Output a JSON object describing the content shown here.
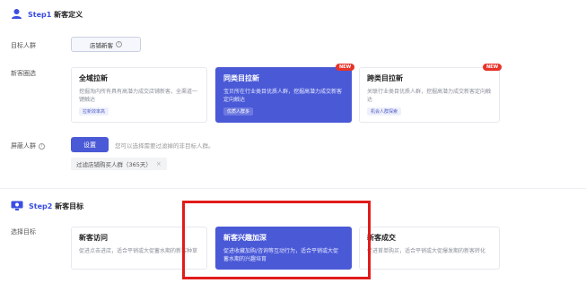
{
  "step1": {
    "prefix": "Step1",
    "title": "新客定义"
  },
  "target_crowd": {
    "label": "目标人群",
    "chip": "店铺新客",
    "info_glyph": "i"
  },
  "circle": {
    "label": "新客圈选",
    "cards": [
      {
        "title": "全域拉新",
        "desc": "挖掘淘内所有具有高潜力成交店铺新客，全渠道一键触达",
        "tag": "拉新效率高"
      },
      {
        "title": "同类目拉新",
        "desc": "宝贝所在行业类目优质人群，挖掘高潜力成交新客定向触达",
        "tag": "优质人群多",
        "badge": "NEW"
      },
      {
        "title": "跨类目拉新",
        "desc": "关联行业类目优质人群，挖掘高潜力成交新客定向触达",
        "tag": "机会人群探索",
        "badge": "NEW"
      }
    ]
  },
  "shield": {
    "label": "屏蔽人群",
    "button": "设置",
    "hint": "您可以选择需要过滤掉的非目标人群。",
    "tag": "过滤店铺购买人群（365天）",
    "close_glyph": "×"
  },
  "step2": {
    "prefix": "Step2",
    "title": "新客目标"
  },
  "goal": {
    "label": "选择目标",
    "cards": [
      {
        "title": "新客访问",
        "desc": "促进点击进店，适合平销或大促蓄水期的新客种草"
      },
      {
        "title": "新客兴趣加深",
        "desc": "促进收藏加购/咨询等互动行为，适合平销或大促蓄水期的兴趣培育"
      },
      {
        "title": "新客成交",
        "desc": "促进首单购买，适合平销或大促爆发期的新客转化"
      }
    ]
  },
  "colors": {
    "accent": "#4a59d6",
    "highlight": "#e21b1b",
    "badge": "#e8332a"
  },
  "icons": {
    "step1": "person-icon",
    "step2": "target-screen-icon",
    "info": "info-icon",
    "close": "close-icon"
  }
}
